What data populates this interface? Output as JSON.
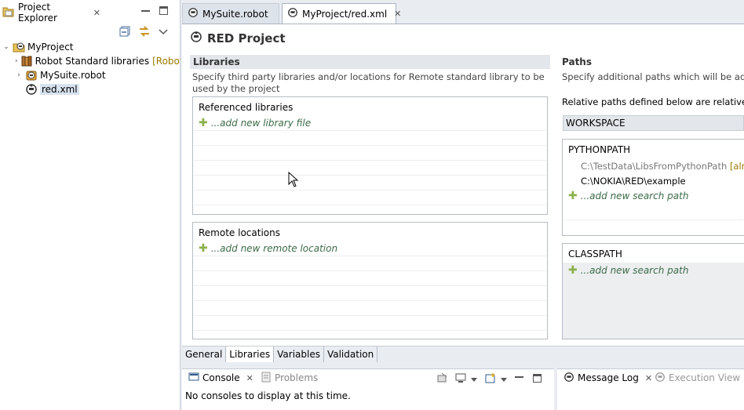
{
  "explorer": {
    "tab_label": "Project Explorer",
    "tree": [
      {
        "label": "MyProject",
        "decor": ""
      },
      {
        "label": "Robot Standard libraries",
        "decor": "[Robot F"
      },
      {
        "label": "MySuite.robot",
        "decor": ""
      },
      {
        "label": "red.xml",
        "decor": ""
      }
    ]
  },
  "editor": {
    "tabs": [
      {
        "label": "MySuite.robot"
      },
      {
        "label": "MyProject/red.xml"
      }
    ],
    "title": "RED Project",
    "libraries": {
      "header": "Libraries",
      "description": "Specify third party libraries and/or locations for Remote standard library to be used by the project",
      "referenced_title": "Referenced libraries",
      "add_library": "...add new library file",
      "remote_title": "Remote locations",
      "add_remote": "...add new remote location"
    },
    "paths": {
      "header": "Paths",
      "description": "Specify additional paths which will be added when communicating with Robot Framewo",
      "relative_label": "Relative paths defined below are relative to:",
      "relative_value": "WORKSPACE",
      "pythonpath_title": "PYTHONPATH",
      "pythonpath_entries": [
        {
          "path": "C:\\TestData\\LibsFromPythonPath",
          "decor": "[alrea"
        },
        {
          "path": "C:\\NOKIA\\RED\\example",
          "decor": ""
        }
      ],
      "add_search_path": "...add new search path",
      "classpath_title": "CLASSPATH",
      "add_classpath": "...add new search path"
    },
    "page_tabs": [
      "General",
      "Libraries",
      "Variables",
      "Validation"
    ]
  },
  "console": {
    "tabs": [
      "Console",
      "Problems"
    ],
    "message": "No consoles to display at this time."
  },
  "message_log": {
    "tabs": [
      "Message Log",
      "Execution View"
    ]
  }
}
